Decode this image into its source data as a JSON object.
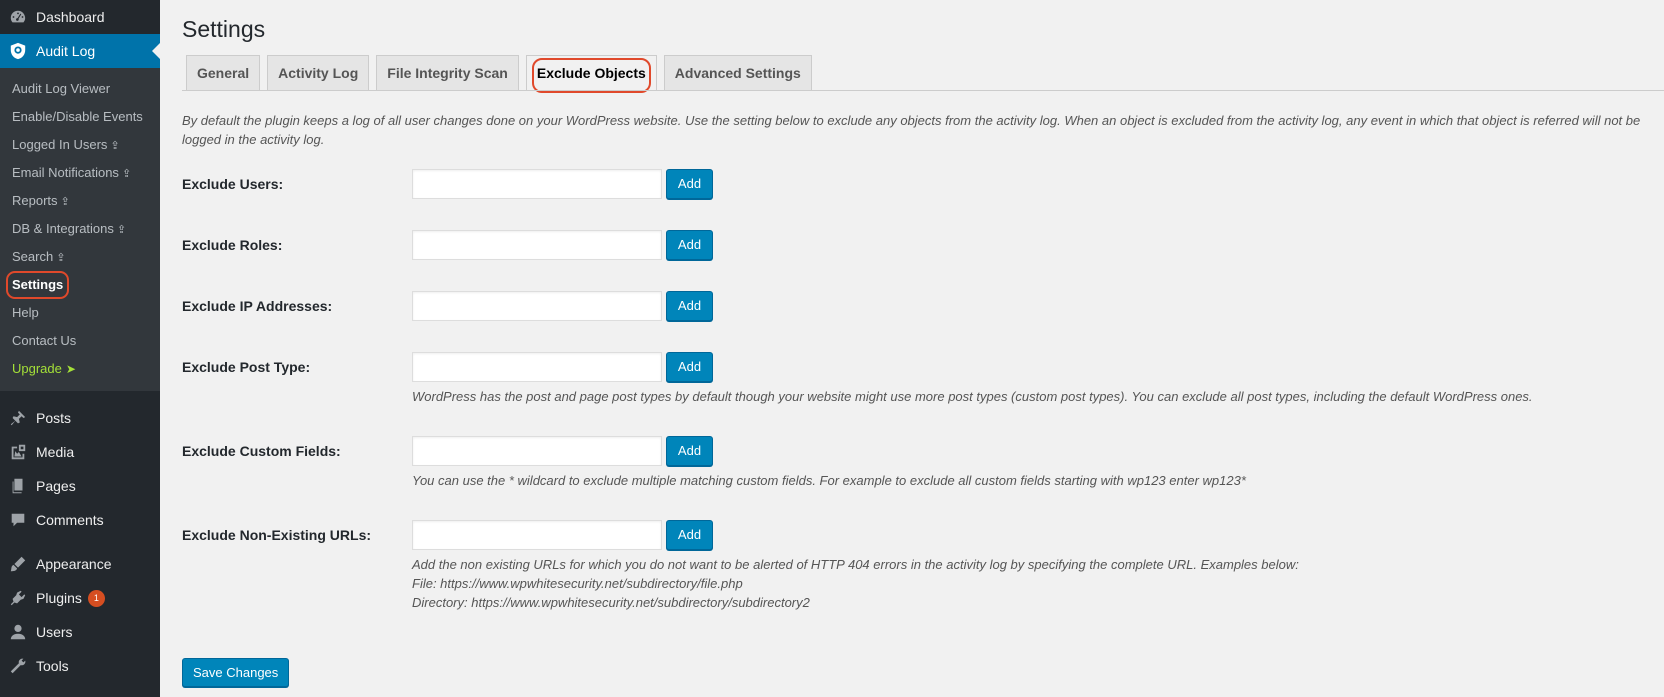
{
  "sidebar": {
    "dashboard": {
      "label": "Dashboard",
      "icon": "dashboard-icon"
    },
    "audit_log": {
      "label": "Audit Log",
      "icon": "audit-log-icon"
    },
    "submenu": [
      {
        "label": "Audit Log Viewer"
      },
      {
        "label": "Enable/Disable Events"
      },
      {
        "label": "Logged In Users",
        "upgrade_icon": "⇪"
      },
      {
        "label": "Email Notifications",
        "upgrade_icon": "⇪"
      },
      {
        "label": "Reports",
        "upgrade_icon": "⇪"
      },
      {
        "label": "DB & Integrations",
        "upgrade_icon": "⇪"
      },
      {
        "label": "Search",
        "upgrade_icon": "⇪"
      },
      {
        "label": "Settings"
      },
      {
        "label": "Help"
      },
      {
        "label": "Contact Us"
      },
      {
        "label": "Upgrade",
        "arrow": "➤"
      }
    ],
    "menu": [
      {
        "label": "Posts",
        "icon": "pin-icon"
      },
      {
        "label": "Media",
        "icon": "media-icon"
      },
      {
        "label": "Pages",
        "icon": "pages-icon"
      },
      {
        "label": "Comments",
        "icon": "comments-icon"
      },
      {
        "label": "Appearance",
        "icon": "appearance-icon"
      },
      {
        "label": "Plugins",
        "icon": "plugins-icon",
        "badge": "1"
      },
      {
        "label": "Users",
        "icon": "users-icon"
      },
      {
        "label": "Tools",
        "icon": "tools-icon"
      }
    ]
  },
  "main": {
    "title": "Settings",
    "tabs": [
      {
        "label": "General"
      },
      {
        "label": "Activity Log"
      },
      {
        "label": "File Integrity Scan"
      },
      {
        "label": "Exclude Objects"
      },
      {
        "label": "Advanced Settings"
      }
    ],
    "intro": "By default the plugin keeps a log of all user changes done on your WordPress website. Use the setting below to exclude any objects from the activity log. When an object is excluded from the activity log, any event in which that object is referred will not be logged in the activity log.",
    "rows": [
      {
        "label": "Exclude Users:",
        "value": "",
        "button": "Add"
      },
      {
        "label": "Exclude Roles:",
        "value": "",
        "button": "Add"
      },
      {
        "label": "Exclude IP Addresses:",
        "value": "",
        "button": "Add"
      },
      {
        "label": "Exclude Post Type:",
        "value": "",
        "button": "Add",
        "desc": "WordPress has the post and page post types by default though your website might use more post types (custom post types). You can exclude all post types, including the default WordPress ones."
      },
      {
        "label": "Exclude Custom Fields:",
        "value": "",
        "button": "Add",
        "desc": "You can use the * wildcard to exclude multiple matching custom fields. For example to exclude all custom fields starting with wp123 enter wp123*"
      },
      {
        "label": "Exclude Non-Existing URLs:",
        "value": "",
        "button": "Add",
        "desc": "Add the non existing URLs for which you do not want to be alerted of HTTP 404 errors in the activity log by specifying the complete URL. Examples below:",
        "desc2": "File: https://www.wpwhitesecurity.net/subdirectory/file.php",
        "desc3": "Directory: https://www.wpwhitesecurity.net/subdirectory/subdirectory2"
      }
    ],
    "save_label": "Save Changes"
  },
  "colors": {
    "sidebar_bg": "#23282d",
    "accent": "#0073aa",
    "button": "#0085ba",
    "highlight_ring": "#e0492b",
    "upgrade": "#a4e038",
    "badge": "#d54e21"
  }
}
